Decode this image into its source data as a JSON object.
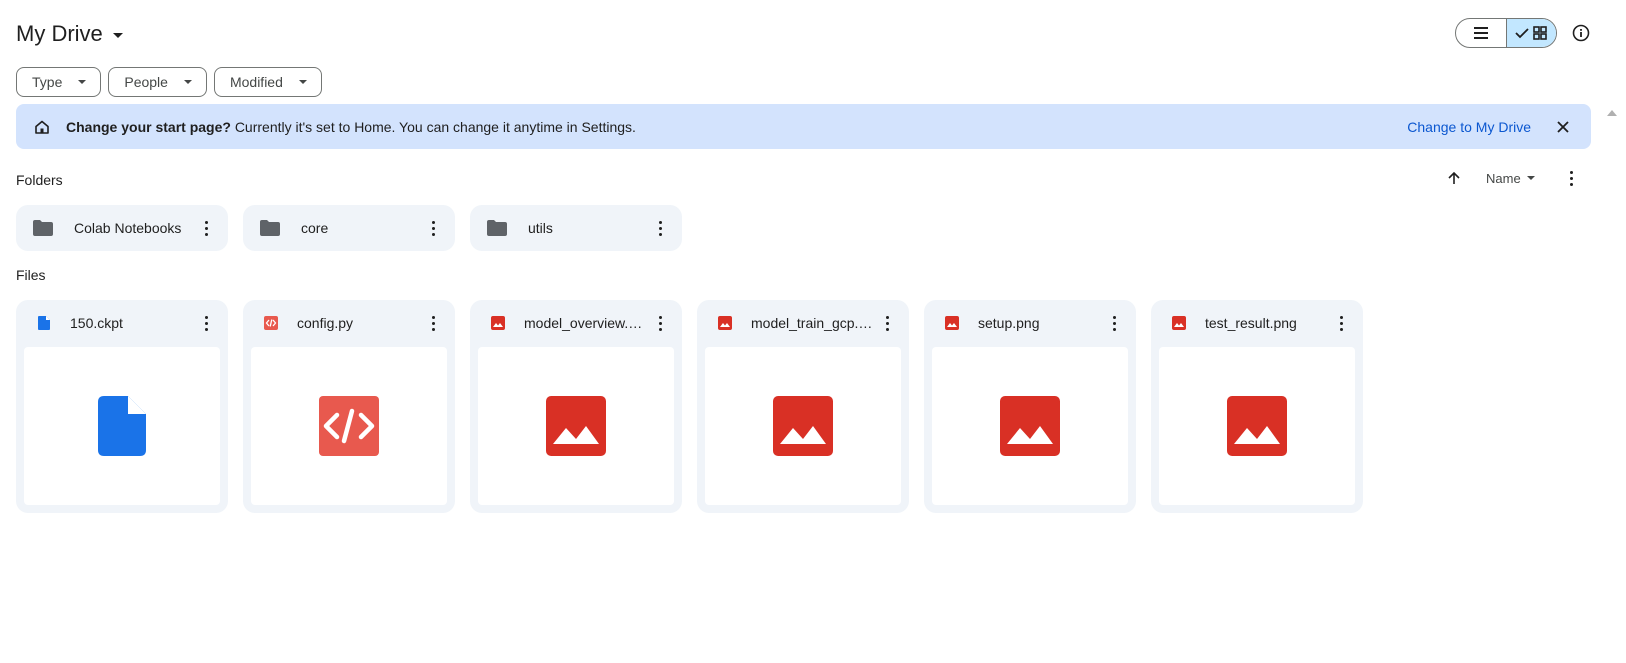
{
  "header": {
    "title": "My Drive",
    "view_toggle": {
      "list_icon": "list-icon",
      "grid_icon": "grid-icon",
      "active": "grid"
    },
    "info_icon": "info-icon"
  },
  "filters": [
    {
      "label": "Type"
    },
    {
      "label": "People"
    },
    {
      "label": "Modified"
    }
  ],
  "banner": {
    "bold": "Change your start page?",
    "text": "Currently it's set to Home. You can change it anytime in Settings.",
    "link": "Change to My Drive",
    "icon": "home-icon"
  },
  "folders_section": {
    "label": "Folders",
    "sort_label": "Name",
    "items": [
      {
        "name": "Colab Notebooks"
      },
      {
        "name": "core"
      },
      {
        "name": "utils"
      }
    ]
  },
  "files_section": {
    "label": "Files",
    "items": [
      {
        "name": "150.ckpt",
        "type": "document"
      },
      {
        "name": "config.py",
        "type": "code"
      },
      {
        "name": "model_overview.png",
        "type": "image"
      },
      {
        "name": "model_train_gcp.png",
        "type": "image"
      },
      {
        "name": "setup.png",
        "type": "image"
      },
      {
        "name": "test_result.png",
        "type": "image"
      }
    ]
  },
  "colors": {
    "banner_bg": "#d3e3fd",
    "link": "#0b57d0",
    "card_bg": "#f0f4f9",
    "image_red": "#d93025",
    "doc_blue": "#1a73e8",
    "code_red": "#e8594e",
    "toggle_active": "#c2e7ff"
  }
}
